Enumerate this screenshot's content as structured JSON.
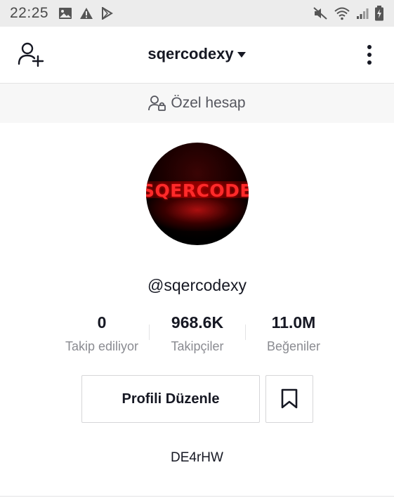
{
  "status_bar": {
    "time": "22:25",
    "left_icons": [
      "image-icon",
      "warning-icon",
      "play-store-icon"
    ],
    "right_icons": [
      "mute-icon",
      "wifi-icon",
      "signal-icon",
      "battery-icon"
    ]
  },
  "header": {
    "title": "sqercodexy",
    "left_icon": "add-user-icon",
    "right_icon": "more-options-icon"
  },
  "private_banner": {
    "icon": "private-account-icon",
    "label": "Özel hesap"
  },
  "profile": {
    "avatar_text": "SQERCODEXY",
    "handle": "@sqercodexy",
    "bio": "DE4rHW"
  },
  "stats": {
    "following": {
      "value": "0",
      "label": "Takip ediliyor"
    },
    "followers": {
      "value": "968.6K",
      "label": "Takipçiler"
    },
    "likes": {
      "value": "11.0M",
      "label": "Beğeniler"
    }
  },
  "actions": {
    "edit_profile_label": "Profili Düzenle",
    "bookmark_icon": "bookmark-icon"
  },
  "colors": {
    "text_primary": "#161823",
    "text_secondary": "#8a8b91",
    "status_bar_bg": "#ececec",
    "banner_bg": "#f7f7f7",
    "divider": "#e3e3e4",
    "avatar_accent": "#ff2a2a"
  }
}
